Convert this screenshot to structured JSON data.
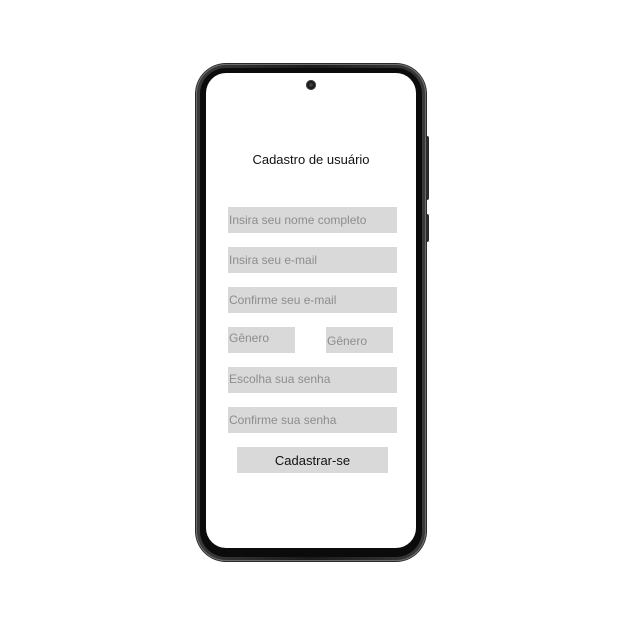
{
  "screen": {
    "title": "Cadastro de usuário"
  },
  "form": {
    "full_name_placeholder": "Insira seu nome completo",
    "email_placeholder": "Insira seu e-mail",
    "confirm_email_placeholder": "Confirme seu e-mail",
    "gender_placeholder_1": "Gênero",
    "gender_placeholder_2": "Gênero",
    "password_placeholder": "Escolha sua senha",
    "confirm_password_placeholder": "Confirme sua senha",
    "submit_label": "Cadastrar-se"
  },
  "icons": {
    "camera": "front-camera-icon"
  },
  "colors": {
    "field_background": "#d9d9d9",
    "placeholder_text": "#8d8d8d",
    "phone_frame": "#1b1b1b",
    "screen_background": "#ffffff"
  }
}
